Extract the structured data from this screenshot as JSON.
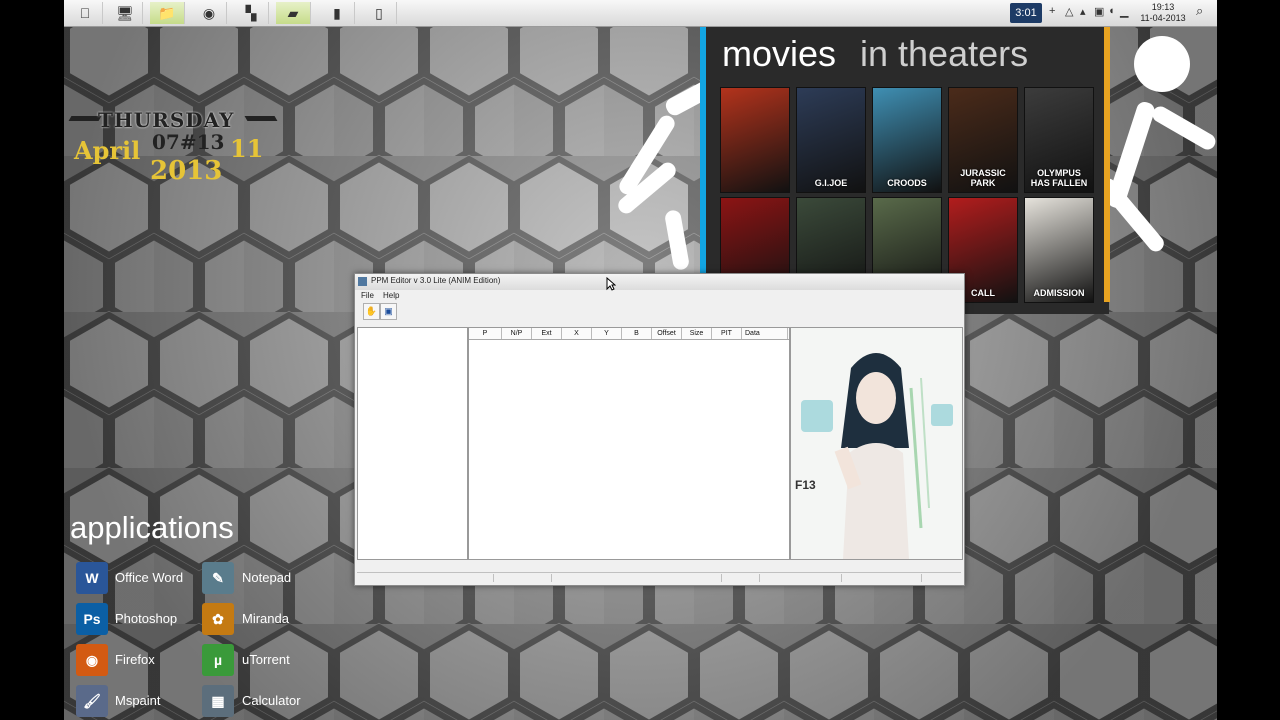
{
  "taskbar": {
    "icons": [
      "apple-icon",
      "computer-icon",
      "folder-icon",
      "app-circle-icon",
      "toolbox-icon",
      "sticky-note-icon",
      "usb-drive-icon",
      "phone-icon"
    ],
    "clock_badge": "3:01",
    "time": "19:13",
    "date": "11-04-2013"
  },
  "date_widget": {
    "day": "THURSDAY",
    "month": "April",
    "date_code": "07#13",
    "day_number": "11",
    "year": "2013"
  },
  "movies": {
    "title_word1": "movies",
    "title_word2": "in theaters",
    "posters": [
      {
        "label": "",
        "color": "#b3331c"
      },
      {
        "label": "G.I.JOE",
        "color": "#2d3c57"
      },
      {
        "label": "CROODS",
        "color": "#3f8fb3"
      },
      {
        "label": "JURASSIC PARK",
        "color": "#4b2b1a"
      },
      {
        "label": "OLYMPUS HAS FALLEN",
        "color": "#3c3c3c"
      },
      {
        "label": "",
        "color": "#8c1414"
      },
      {
        "label": "",
        "color": "#3b4a3a"
      },
      {
        "label": "",
        "color": "#596a4a"
      },
      {
        "label": "CALL",
        "color": "#b21d1d"
      },
      {
        "label": "ADMISSION",
        "color": "#e6e3dc"
      }
    ]
  },
  "applications": {
    "title": "applications",
    "items": [
      {
        "label": "Office Word",
        "icon": "word-icon",
        "glyph": "W",
        "color": "#2a5699"
      },
      {
        "label": "Notepad",
        "icon": "notepad-icon",
        "glyph": "✎",
        "color": "#5a7c8c"
      },
      {
        "label": "Photoshop",
        "icon": "photoshop-icon",
        "glyph": "Ps",
        "color": "#0b5fa5"
      },
      {
        "label": "Miranda",
        "icon": "miranda-icon",
        "glyph": "✿",
        "color": "#c47a12"
      },
      {
        "label": "Firefox",
        "icon": "firefox-icon",
        "glyph": "◉",
        "color": "#d35a12"
      },
      {
        "label": "uTorrent",
        "icon": "utorrent-icon",
        "glyph": "µ",
        "color": "#3a9a3a"
      },
      {
        "label": "Mspaint",
        "icon": "paint-icon",
        "glyph": "🖌",
        "color": "#5a6a8a"
      },
      {
        "label": "Calculator",
        "icon": "calculator-icon",
        "glyph": "▦",
        "color": "#5c6e7c"
      }
    ]
  },
  "ppm_window": {
    "title": "PPM Editor v 3.0 Lite (ANIM Edition)",
    "menu": [
      "File",
      "Help"
    ],
    "columns": [
      "P",
      "N/P",
      "Ext",
      "X",
      "Y",
      "B",
      "Offset",
      "Size",
      "PIT",
      "Data"
    ],
    "preview_caption": "F13"
  }
}
